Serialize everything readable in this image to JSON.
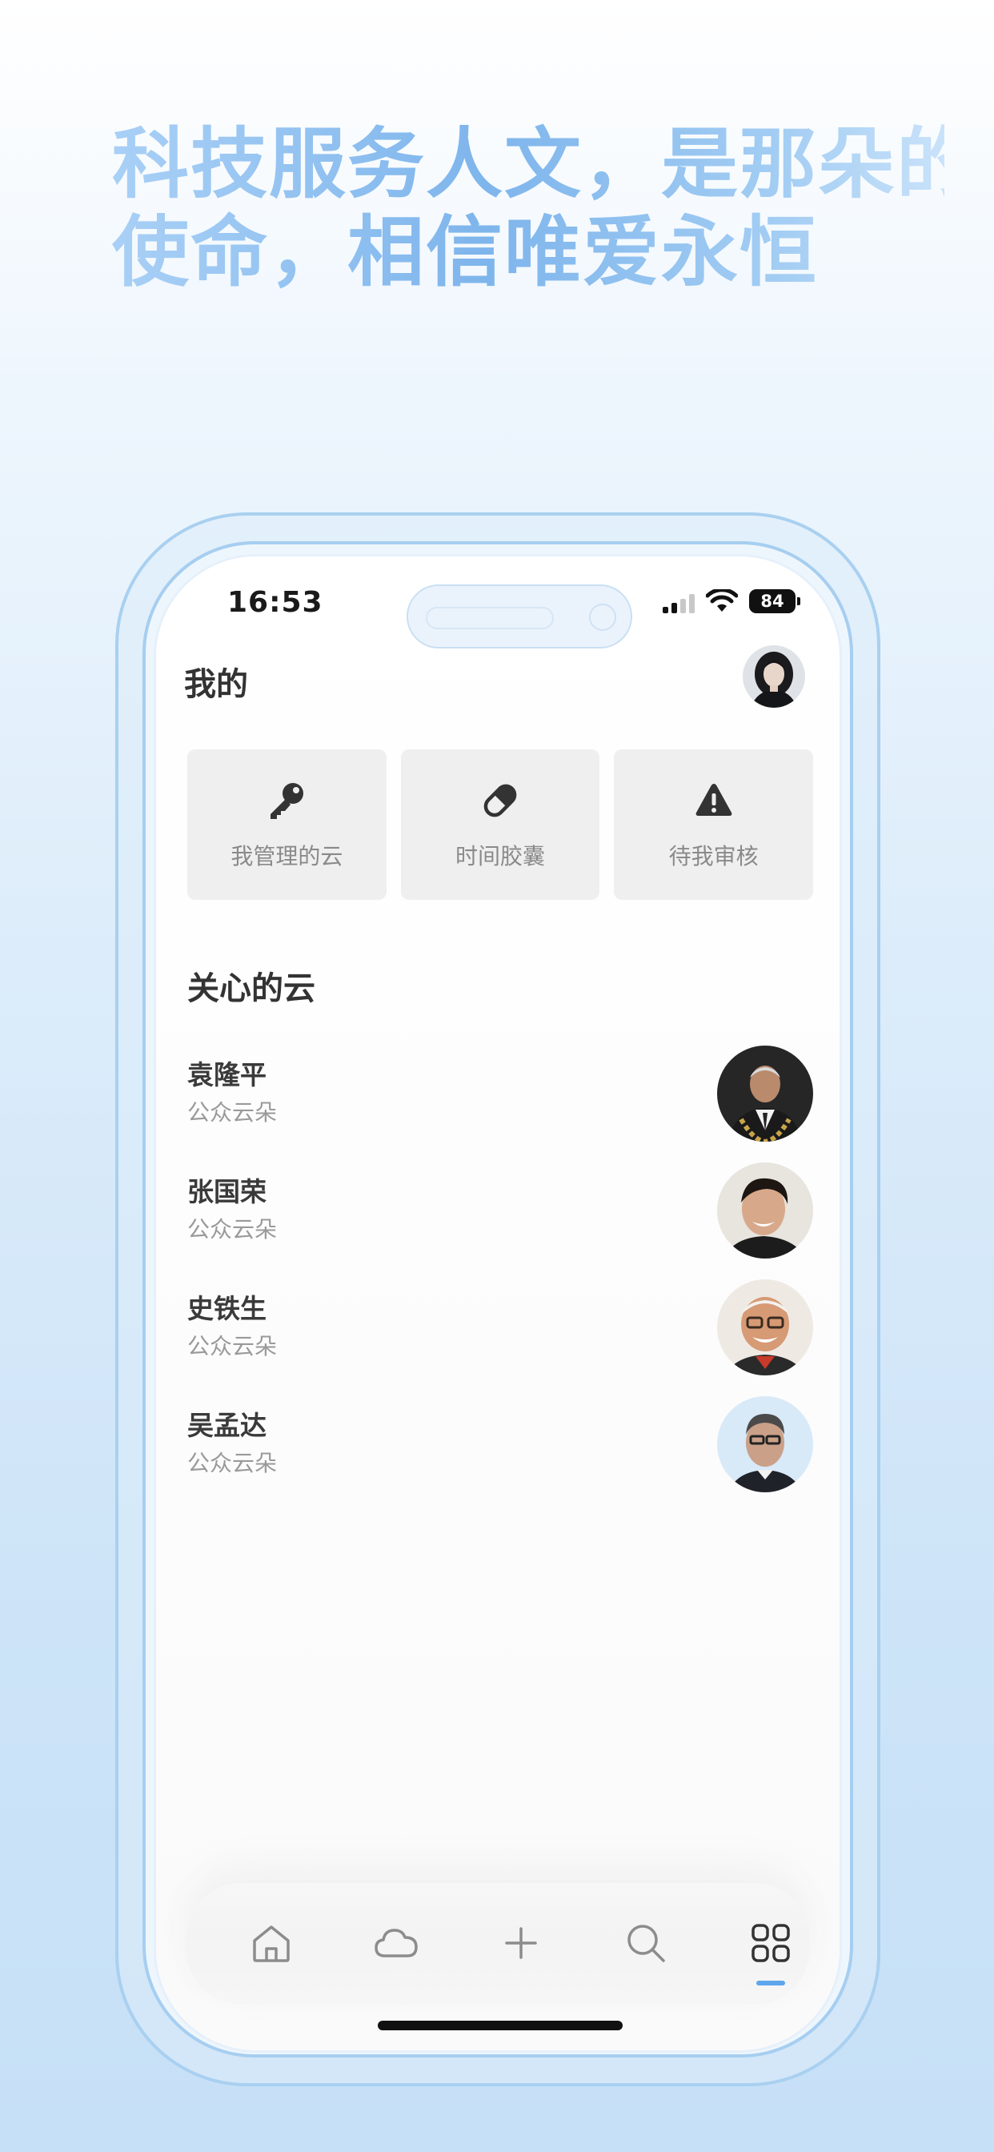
{
  "headline": {
    "line1": "科技服务人文，是那朵的",
    "line2": "使命，相信唯爱永恒"
  },
  "status_bar": {
    "time": "16:53",
    "battery": "84"
  },
  "header": {
    "title": "我的"
  },
  "cards": [
    {
      "label": "我管理的云",
      "icon": "key-icon"
    },
    {
      "label": "时间胶囊",
      "icon": "pill-icon"
    },
    {
      "label": "待我审核",
      "icon": "warning-icon"
    }
  ],
  "section": {
    "title": "关心的云"
  },
  "clouds": [
    {
      "name": "袁隆平",
      "subtitle": "公众云朵"
    },
    {
      "name": "张国荣",
      "subtitle": "公众云朵"
    },
    {
      "name": "史铁生",
      "subtitle": "公众云朵"
    },
    {
      "name": "吴孟达",
      "subtitle": "公众云朵"
    }
  ],
  "tabbar": {
    "items": [
      {
        "name": "home",
        "icon": "home-icon"
      },
      {
        "name": "cloud",
        "icon": "cloud-icon"
      },
      {
        "name": "add",
        "icon": "plus-icon"
      },
      {
        "name": "search",
        "icon": "search-icon"
      },
      {
        "name": "mine",
        "icon": "grid-icon",
        "active": true
      }
    ]
  },
  "colors": {
    "accent": "#5ea6ec",
    "headline_gradient_start": "#a9d0f6",
    "headline_gradient_mid": "#7eb5ec",
    "card_bg": "#efefef",
    "frame": "#a9d0f0"
  }
}
